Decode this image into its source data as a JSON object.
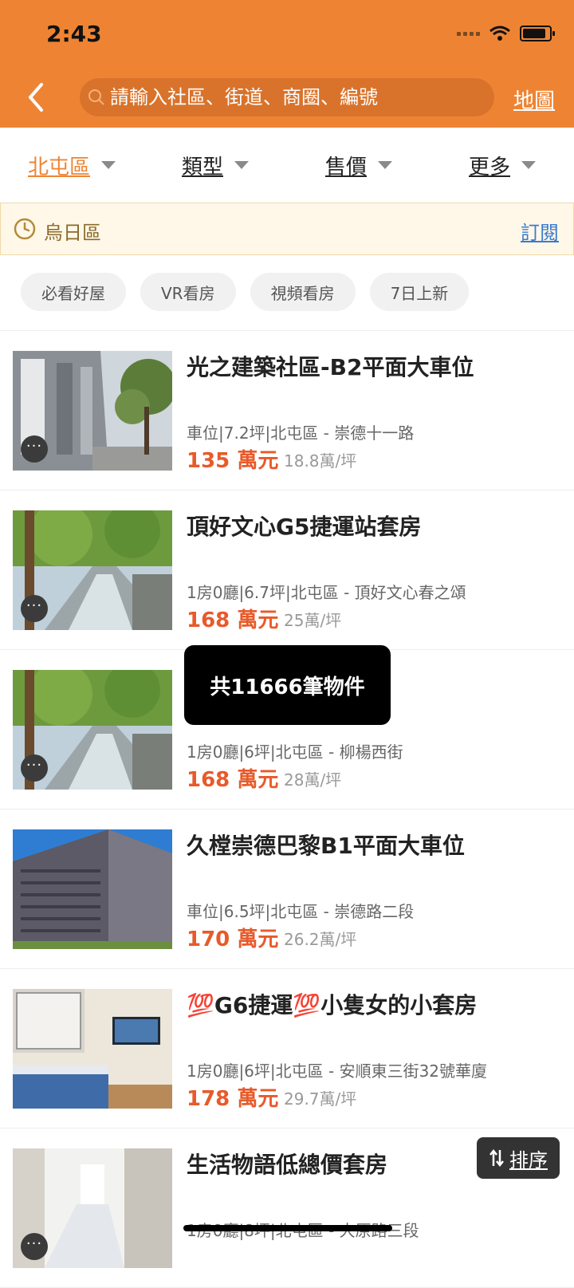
{
  "status_bar": {
    "time": "2:43"
  },
  "header": {
    "search_placeholder": "請輸入社區、街道、商圈、編號",
    "map_label": "地圖"
  },
  "filters": [
    {
      "label": "北屯區",
      "active": true
    },
    {
      "label": "類型",
      "active": false
    },
    {
      "label": "售價",
      "active": false
    },
    {
      "label": "更多",
      "active": false
    }
  ],
  "recent": {
    "area": "烏日區",
    "subscribe_label": "訂閱"
  },
  "chips": [
    "必看好屋",
    "VR看房",
    "視頻看房",
    "7日上新"
  ],
  "listings": [
    {
      "title": "光之建築社區-B2平面大車位",
      "meta": "車位|7.2坪|北屯區 - 崇德十一路",
      "price": "135",
      "price_unit": "萬元",
      "unit_price": "18.8萬/坪",
      "image": "building-photo"
    },
    {
      "title": "頂好文心G5捷運站套房",
      "meta": "1房0廳|6.7坪|北屯區 - 頂好文心春之頌",
      "price": "168",
      "price_unit": "萬元",
      "unit_price": "25萬/坪",
      "image": "canal-photo"
    },
    {
      "title": "",
      "meta": "1房0廳|6坪|北屯區 - 柳楊西街",
      "price": "168",
      "price_unit": "萬元",
      "unit_price": "28萬/坪",
      "image": "canal-photo"
    },
    {
      "title": "久樘崇德巴黎B1平面大車位",
      "meta": "車位|6.5坪|北屯區 - 崇德路二段",
      "price": "170",
      "price_unit": "萬元",
      "unit_price": "26.2萬/坪",
      "image": "tower-photo"
    },
    {
      "title": "💯G6捷運💯小隻女的小套房",
      "meta": "1房0廳|6坪|北屯區 - 安順東三街32號華廈",
      "price": "178",
      "price_unit": "萬元",
      "unit_price": "29.7萬/坪",
      "image": "room-photo"
    },
    {
      "title": "生活物語低總價套房",
      "meta": "1房0廳|8坪|北屯區 - 大原路三段",
      "price": "",
      "price_unit": "",
      "unit_price": "",
      "image": "corridor-photo"
    }
  ],
  "toast": "共11666筆物件",
  "sort_label": "排序",
  "colors": {
    "brand_orange": "#EE8433",
    "price_red": "#E85A2A",
    "link_blue": "#3B7BD0"
  }
}
